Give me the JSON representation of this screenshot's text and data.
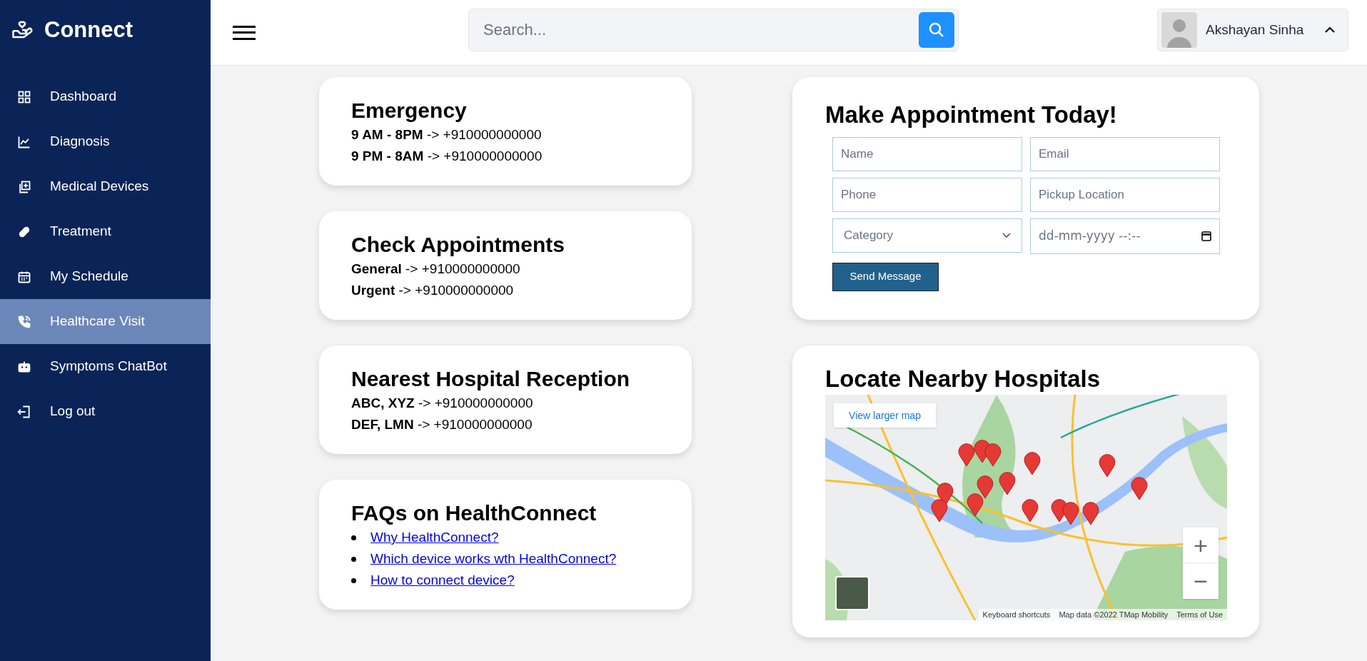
{
  "brand": {
    "name": "Connect"
  },
  "sidebar": {
    "items": [
      {
        "label": "Dashboard",
        "selected": false
      },
      {
        "label": "Diagnosis",
        "selected": false
      },
      {
        "label": "Medical Devices",
        "selected": false
      },
      {
        "label": "Treatment",
        "selected": false
      },
      {
        "label": "My Schedule",
        "selected": false
      },
      {
        "label": "Healthcare Visit",
        "selected": true
      },
      {
        "label": "Symptoms ChatBot",
        "selected": false
      },
      {
        "label": "Log out",
        "selected": false
      }
    ]
  },
  "header": {
    "search": {
      "placeholder": "Search..."
    },
    "user": {
      "name": "Akshayan Sinha"
    }
  },
  "info_cards": [
    {
      "title": "Emergency",
      "lines": [
        "**9 AM - 8PM** -> +910000000000",
        "**9 PM - 8AM** -> +910000000000"
      ]
    },
    {
      "title": "Check Appointments",
      "lines": [
        "**General** -> +910000000000",
        "**Urgent** -> +910000000000"
      ]
    },
    {
      "title": "Nearest Hospital Reception",
      "lines": [
        "**ABC, XYZ** -> +910000000000",
        "**DEF, LMN** -> +910000000000"
      ]
    }
  ],
  "faq": {
    "title": "FAQs on HealthConnect",
    "links": [
      "Why HealthConnect?",
      "Which device works wth HealthConnect?",
      "How to connect device?"
    ]
  },
  "appointment": {
    "title": "Make Appointment Today!",
    "fields": [
      {
        "kind": "text",
        "placeholder": "Name"
      },
      {
        "kind": "text",
        "placeholder": "Email"
      },
      {
        "kind": "text",
        "placeholder": "Phone"
      },
      {
        "kind": "text",
        "placeholder": "Pickup Location"
      },
      {
        "kind": "select",
        "placeholder": "Category"
      },
      {
        "kind": "datetime",
        "placeholder": "dd-mm-yyyy --:--"
      }
    ],
    "submit": "Send Message"
  },
  "map_card": {
    "title": "Locate Nearby Hospitals",
    "map": {
      "kind": "picture",
      "larger_link": "View larger map",
      "zoom_in": "+",
      "zoom_out": "−",
      "footer": [
        "Keyboard shortcuts",
        "Map data ©2022 TMap Mobility",
        "Terms of Use"
      ]
    }
  }
}
